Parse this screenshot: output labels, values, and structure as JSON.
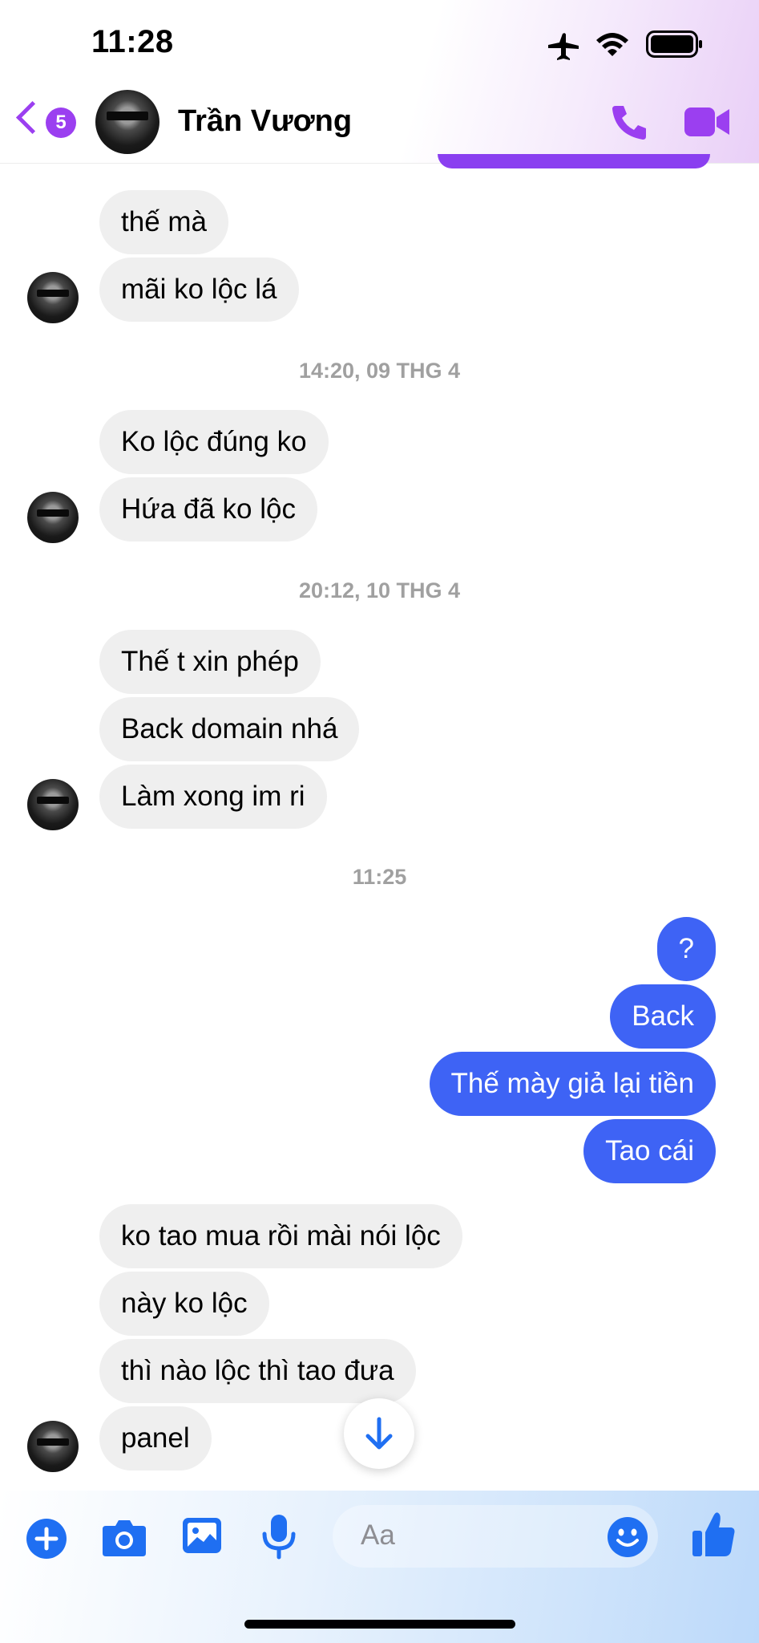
{
  "status_bar": {
    "time": "11:28"
  },
  "header": {
    "back_badge_count": "5",
    "contact_name": "Trần Vương",
    "accent_color": "#9b3ff0"
  },
  "timestamps": [
    "14:20, 09 THG 4",
    "20:12, 10 THG 4",
    "11:25"
  ],
  "messages": {
    "group1": [
      "thế mà",
      "mãi ko lộc lá"
    ],
    "group2": [
      "Ko lộc đúng ko",
      "Hứa đã ko lộc"
    ],
    "group3": [
      "Thế t xin phép",
      "Back domain nhá",
      "Làm xong im ri"
    ],
    "outgoing": [
      "?",
      "Back",
      "Thế mày giả lại tiền",
      "Tao cái"
    ],
    "group4": [
      "ko tao mua rồi mài nói lộc",
      "này ko lộc",
      "thì nào lộc thì tao đưa",
      "panel"
    ]
  },
  "composer": {
    "placeholder": "Aa"
  },
  "colors": {
    "outgoing_bubble": "#3e63f5",
    "incoming_bubble": "#efefef",
    "icon_blue": "#1f6ff2"
  }
}
